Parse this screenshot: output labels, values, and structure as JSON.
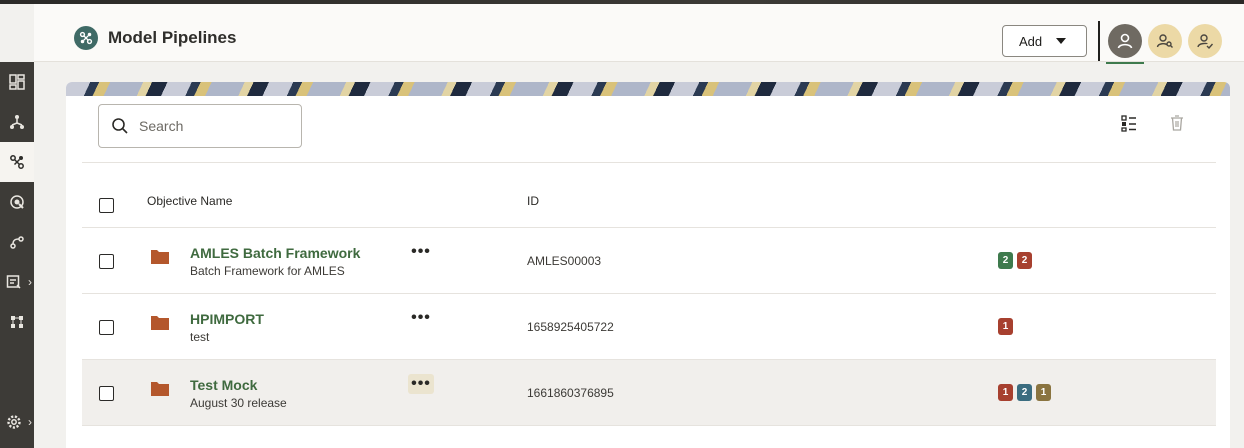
{
  "header": {
    "title": "Model Pipelines",
    "add_label": "Add"
  },
  "nav_rail": {
    "items": [
      {
        "icon": "dashboard-icon"
      },
      {
        "icon": "workflow-icon"
      },
      {
        "icon": "model-pipelines-icon",
        "active": true
      },
      {
        "icon": "analytics-icon"
      },
      {
        "icon": "graph-icon"
      },
      {
        "icon": "reports-icon",
        "expandable": true
      },
      {
        "icon": "hierarchy-icon"
      },
      {
        "icon": "settings-icon",
        "expandable": true
      }
    ]
  },
  "user_avatars": [
    {
      "icon": "user-icon",
      "active": true
    },
    {
      "icon": "user-search-icon"
    },
    {
      "icon": "user-check-icon"
    }
  ],
  "search": {
    "placeholder": "Search"
  },
  "table": {
    "columns": {
      "name": "Objective Name",
      "id": "ID"
    },
    "rows": [
      {
        "name": "AMLES Batch Framework",
        "description": "Batch Framework for AMLES",
        "id": "AMLES00003",
        "badges": [
          {
            "label": "2",
            "color": "#3e7a4d"
          },
          {
            "label": "2",
            "color": "#a7402f"
          }
        ]
      },
      {
        "name": "HPIMPORT",
        "description": "test",
        "id": "1658925405722",
        "badges": [
          {
            "label": "1",
            "color": "#a7402f"
          }
        ]
      },
      {
        "name": "Test Mock",
        "description": "August 30 release",
        "id": "1661860376895",
        "badges": [
          {
            "label": "1",
            "color": "#a7402f"
          },
          {
            "label": "2",
            "color": "#3b6d80"
          },
          {
            "label": "1",
            "color": "#8a7440"
          }
        ]
      }
    ],
    "more_glyph": "•••"
  },
  "colors": {
    "rail_bg": "#3d3b37",
    "link_green": "#3f6a3f",
    "folder_orange": "#b4572c",
    "accent_teal": "#3f6a66"
  }
}
